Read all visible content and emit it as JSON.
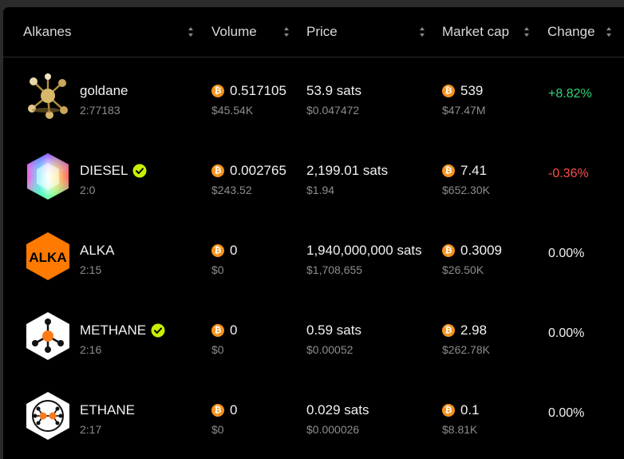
{
  "columns": {
    "alkanes": "Alkanes",
    "volume": "Volume",
    "price": "Price",
    "market_cap": "Market cap",
    "change": "Change"
  },
  "colors": {
    "positive": "#2fd27a",
    "negative": "#ff4d4d",
    "neutral": "#f2f2f2",
    "btc": "#f7931a",
    "verified": "#c6f000"
  },
  "rows": [
    {
      "name": "goldane",
      "id": "2:77183",
      "verified": false,
      "icon": "goldane-molecule-icon",
      "volume_btc": "0.517105",
      "volume_usd": "$45.54K",
      "price_sats": "53.9 sats",
      "price_usd": "$0.047472",
      "mcap_btc": "539",
      "mcap_usd": "$47.47M",
      "change": "+8.82%",
      "change_dir": "positive"
    },
    {
      "name": "DIESEL",
      "id": "2:0",
      "verified": true,
      "icon": "diesel-hexagon-icon",
      "volume_btc": "0.002765",
      "volume_usd": "$243.52",
      "price_sats": "2,199.01 sats",
      "price_usd": "$1.94",
      "mcap_btc": "7.41",
      "mcap_usd": "$652.30K",
      "change": "-0.36%",
      "change_dir": "negative"
    },
    {
      "name": "ALKA",
      "id": "2:15",
      "verified": false,
      "icon": "alka-logo-icon",
      "volume_btc": "0",
      "volume_usd": "$0",
      "price_sats": "1,940,000,000 sats",
      "price_usd": "$1,708,655",
      "mcap_btc": "0.3009",
      "mcap_usd": "$26.50K",
      "change": "0.00%",
      "change_dir": "neutral"
    },
    {
      "name": "METHANE",
      "id": "2:16",
      "verified": true,
      "icon": "methane-molecule-icon",
      "volume_btc": "0",
      "volume_usd": "$0",
      "price_sats": "0.59 sats",
      "price_usd": "$0.00052",
      "mcap_btc": "2.98",
      "mcap_usd": "$262.78K",
      "change": "0.00%",
      "change_dir": "neutral"
    },
    {
      "name": "ETHANE",
      "id": "2:17",
      "verified": false,
      "icon": "ethane-molecule-icon",
      "volume_btc": "0",
      "volume_usd": "$0",
      "price_sats": "0.029 sats",
      "price_usd": "$0.000026",
      "mcap_btc": "0.1",
      "mcap_usd": "$8.81K",
      "change": "0.00%",
      "change_dir": "neutral"
    }
  ]
}
